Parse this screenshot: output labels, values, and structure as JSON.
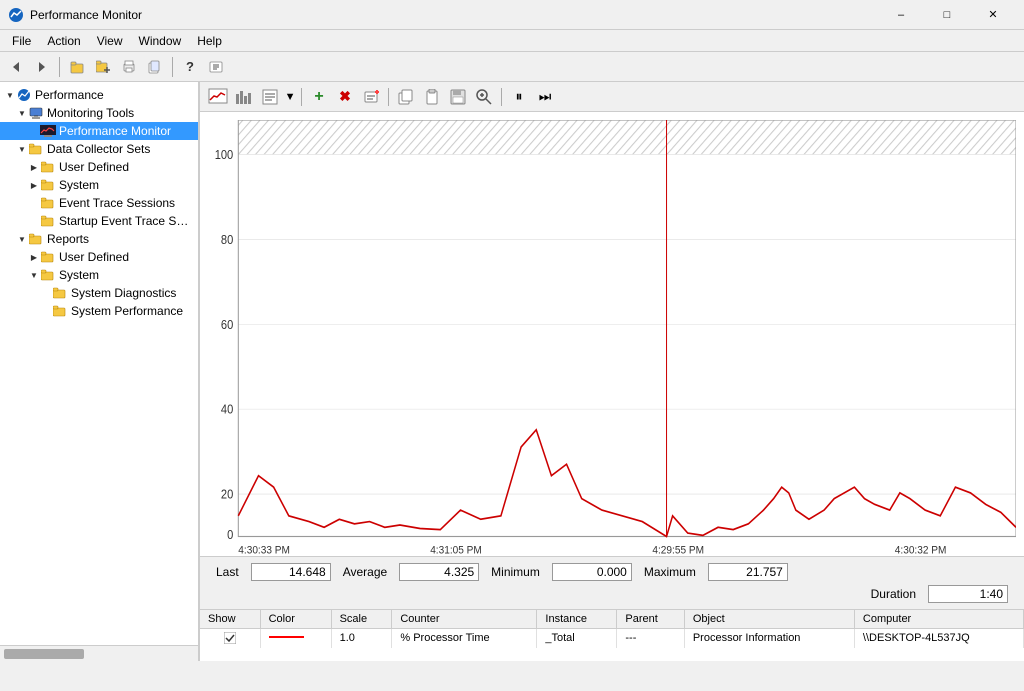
{
  "window": {
    "title": "Performance Monitor",
    "icon": "⚡"
  },
  "menubar": {
    "items": [
      "File",
      "Action",
      "View",
      "Window",
      "Help"
    ]
  },
  "toolbar": {
    "buttons": [
      "⬅",
      "➡",
      "📁",
      "📋",
      "🖨",
      "✉",
      "❓",
      "📊"
    ]
  },
  "tree": {
    "root": "Performance",
    "items": [
      {
        "id": "monitoring-tools",
        "label": "Monitoring Tools",
        "indent": 1,
        "hasToggle": true,
        "expanded": true,
        "icon": "monitor"
      },
      {
        "id": "performance-monitor",
        "label": "Performance Monitor",
        "indent": 2,
        "hasToggle": false,
        "icon": "chart",
        "selected": true
      },
      {
        "id": "data-collector-sets",
        "label": "Data Collector Sets",
        "indent": 1,
        "hasToggle": true,
        "expanded": true,
        "icon": "folder"
      },
      {
        "id": "user-defined-1",
        "label": "User Defined",
        "indent": 2,
        "hasToggle": true,
        "icon": "folder"
      },
      {
        "id": "system-1",
        "label": "System",
        "indent": 2,
        "hasToggle": true,
        "icon": "folder"
      },
      {
        "id": "event-trace",
        "label": "Event Trace Sessions",
        "indent": 2,
        "hasToggle": false,
        "icon": "folder"
      },
      {
        "id": "startup-event",
        "label": "Startup Event Trace Sess...",
        "indent": 2,
        "hasToggle": false,
        "icon": "folder"
      },
      {
        "id": "reports",
        "label": "Reports",
        "indent": 1,
        "hasToggle": true,
        "expanded": true,
        "icon": "folder"
      },
      {
        "id": "user-defined-2",
        "label": "User Defined",
        "indent": 2,
        "hasToggle": true,
        "icon": "folder"
      },
      {
        "id": "system-2",
        "label": "System",
        "indent": 2,
        "hasToggle": true,
        "expanded": true,
        "icon": "folder"
      },
      {
        "id": "system-diagnostics",
        "label": "System Diagnostics",
        "indent": 3,
        "hasToggle": false,
        "icon": "folder"
      },
      {
        "id": "system-performance",
        "label": "System Performance",
        "indent": 3,
        "hasToggle": false,
        "icon": "folder"
      }
    ]
  },
  "chart": {
    "yMax": 100,
    "yTicks": [
      0,
      20,
      40,
      60,
      80,
      100
    ],
    "timeLabels": [
      "4:30:33 PM",
      "4:31:05 PM",
      "4:29:55 PM",
      "4:30:32 PM"
    ],
    "cursorLineX": 0.55
  },
  "stats": {
    "last_label": "Last",
    "last_value": "14.648",
    "average_label": "Average",
    "average_value": "4.325",
    "minimum_label": "Minimum",
    "minimum_value": "0.000",
    "maximum_label": "Maximum",
    "maximum_value": "21.757",
    "duration_label": "Duration",
    "duration_value": "1:40"
  },
  "counter_table": {
    "headers": [
      "Show",
      "Color",
      "Scale",
      "Counter",
      "Instance",
      "Parent",
      "Object",
      "Computer"
    ],
    "rows": [
      {
        "show": true,
        "color": "red",
        "scale": "1.0",
        "counter": "% Processor Time",
        "instance": "_Total",
        "parent": "---",
        "object": "Processor Information",
        "computer": "\\\\DESKTOP-4L537JQ"
      }
    ]
  }
}
